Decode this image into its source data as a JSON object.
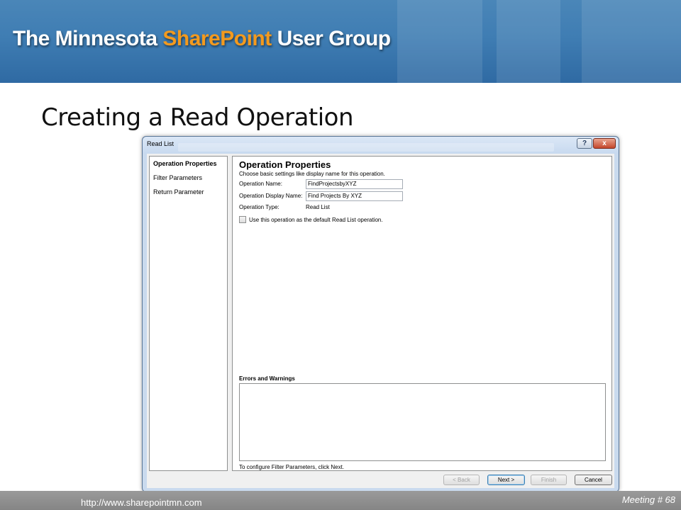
{
  "slide": {
    "banner_title_prefix": "The Minnesota ",
    "banner_title_accent": "SharePoint",
    "banner_title_suffix": " User Group",
    "heading": "Creating a Read Operation",
    "footer_url": "http://www.sharepointmn.com",
    "footer_meeting": "Meeting # 68",
    "accent_color": "#f39a1e"
  },
  "dialog": {
    "title": "Read List",
    "help_label": "?",
    "close_label": "x",
    "nav": [
      {
        "label": "Operation Properties",
        "active": true
      },
      {
        "label": "Filter Parameters",
        "active": false
      },
      {
        "label": "Return Parameter",
        "active": false
      }
    ],
    "content": {
      "title": "Operation Properties",
      "description": "Choose basic settings like display name for this operation.",
      "fields": {
        "name_label": "Operation Name:",
        "name_value": "FindProjectsbyXYZ",
        "display_name_label": "Operation Display Name:",
        "display_name_value": "Find Projects By XYZ",
        "type_label": "Operation Type:",
        "type_value": "Read List"
      },
      "default_checkbox_label": "Use this operation as the default Read List operation.",
      "default_checkbox_checked": false,
      "errors_label": "Errors and Warnings",
      "hint": "To configure Filter Parameters, click Next."
    },
    "buttons": {
      "back": "< Back",
      "next": "Next >",
      "finish": "Finish",
      "cancel": "Cancel"
    }
  }
}
